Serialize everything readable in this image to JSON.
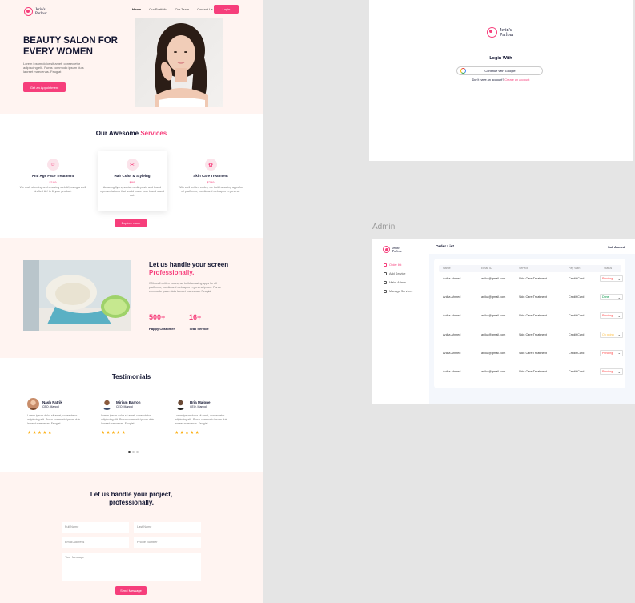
{
  "colors": {
    "accent": "#f63e7b",
    "hero_bg": "#fff4f1",
    "star": "#fbb21c"
  },
  "brand": {
    "line1": "Jerin's",
    "line2": "Parlour"
  },
  "nav": {
    "items": [
      "Home",
      "Our Portfolio",
      "Our Team",
      "Contact Us"
    ],
    "login": "Login"
  },
  "hero": {
    "title": "BEAUTY SALON FOR EVERY WOMEN",
    "text": "Lorem ipsum dolor sit amet, consectetur adipiscing elit. Purus commodo ipsum duis laoreet maecenas. Feugiat",
    "button": "Get an Appointment"
  },
  "services": {
    "title_a": "Our Awesome",
    "title_b": "Services",
    "button": "Explore more",
    "items": [
      {
        "name": "Anti Age Face Treatment",
        "price": "$199",
        "desc": "We craft stunning and amazing web UI, using a well drafted UX to fit your product.",
        "icon": "face-treatment-icon"
      },
      {
        "name": "Hair Color & Styleing",
        "price": "$99",
        "desc": "Amazing flyers, social media posts and brand representations that would make your brand stand out.",
        "icon": "hair-styling-icon"
      },
      {
        "name": "Skin Care Treatment",
        "price": "$299",
        "desc": "With well written codes, we build amazing apps for all platforms, mobile and web apps in general.",
        "icon": "skin-care-icon"
      }
    ]
  },
  "handle": {
    "title_a": "Let us handle your screen",
    "title_b": "Professionally.",
    "text": "With well written codes, we build amazing apps for all platforms, mobile and web apps in general ipsum. Purus commodo ipsum duis laoreet maecenas. Feugiat",
    "stats": [
      {
        "value": "500+",
        "label": "Happy Customer"
      },
      {
        "value": "16+",
        "label": "Total Service"
      }
    ]
  },
  "testimonials": {
    "title": "Testimonials",
    "stars": "★★★★★",
    "items": [
      {
        "name": "Nash Patrik",
        "role": "CEO, Manpol",
        "text": "Lorem ipsum dolor sit amet, consectetur adipiscing elit. Purus commodo ipsum duis laoreet maecenas. Feugiat"
      },
      {
        "name": "Miriam Barron",
        "role": "CEO, Manpol",
        "text": "Lorem ipsum dolor sit amet, consectetur adipiscing elit. Purus commodo ipsum duis laoreet maecenas. Feugiat"
      },
      {
        "name": "Bria Malone",
        "role": "CEO, Manpol",
        "text": "Lorem ipsum dolor sit amet, consectetur adipiscing elit. Purus commodo ipsum duis laoreet maecenas. Feugiat"
      }
    ]
  },
  "contact": {
    "title": "Let us handle your project, professionally.",
    "full_name": "Full Name",
    "last_name": "Last Name",
    "email": "Email Address",
    "phone": "Phone Number",
    "message": "Your Message",
    "button": "Send Message"
  },
  "login": {
    "title": "Login With",
    "google": "Continue with Google",
    "no_account": "Don't have an account?",
    "create": "Create an account"
  },
  "admin": {
    "label": "Admin",
    "title": "Order List",
    "user": "Sufi Ahmed",
    "sidebar": [
      "Order list",
      "Add Service",
      "Make Admin",
      "Manage Services"
    ],
    "columns": [
      "Name",
      "Email ID",
      "Service",
      "Pay With",
      "Status"
    ],
    "rows": [
      {
        "name": "Anika Ahmed",
        "email": "anika@gmail.com",
        "service": "Skin Care Treatment",
        "pay": "Credit Card",
        "status": "Pending",
        "color": "#ff4545"
      },
      {
        "name": "Anika Ahmed",
        "email": "anika@gmail.com",
        "service": "Skin Care Treatment",
        "pay": "Credit Card",
        "status": "Done",
        "color": "#009444"
      },
      {
        "name": "Anika Ahmed",
        "email": "anika@gmail.com",
        "service": "Skin Care Treatment",
        "pay": "Credit Card",
        "status": "Pending",
        "color": "#ff4545"
      },
      {
        "name": "Anika Ahmed",
        "email": "anika@gmail.com",
        "service": "Skin Care Treatment",
        "pay": "Credit Card",
        "status": "On going",
        "color": "#ffbd3e"
      },
      {
        "name": "Anika Ahmed",
        "email": "anika@gmail.com",
        "service": "Skin Care Treatment",
        "pay": "Credit Card",
        "status": "Pending",
        "color": "#ff4545"
      },
      {
        "name": "Anika Ahmed",
        "email": "anika@gmail.com",
        "service": "Skin Care Treatment",
        "pay": "Credit Card",
        "status": "Pending",
        "color": "#ff4545"
      }
    ]
  }
}
